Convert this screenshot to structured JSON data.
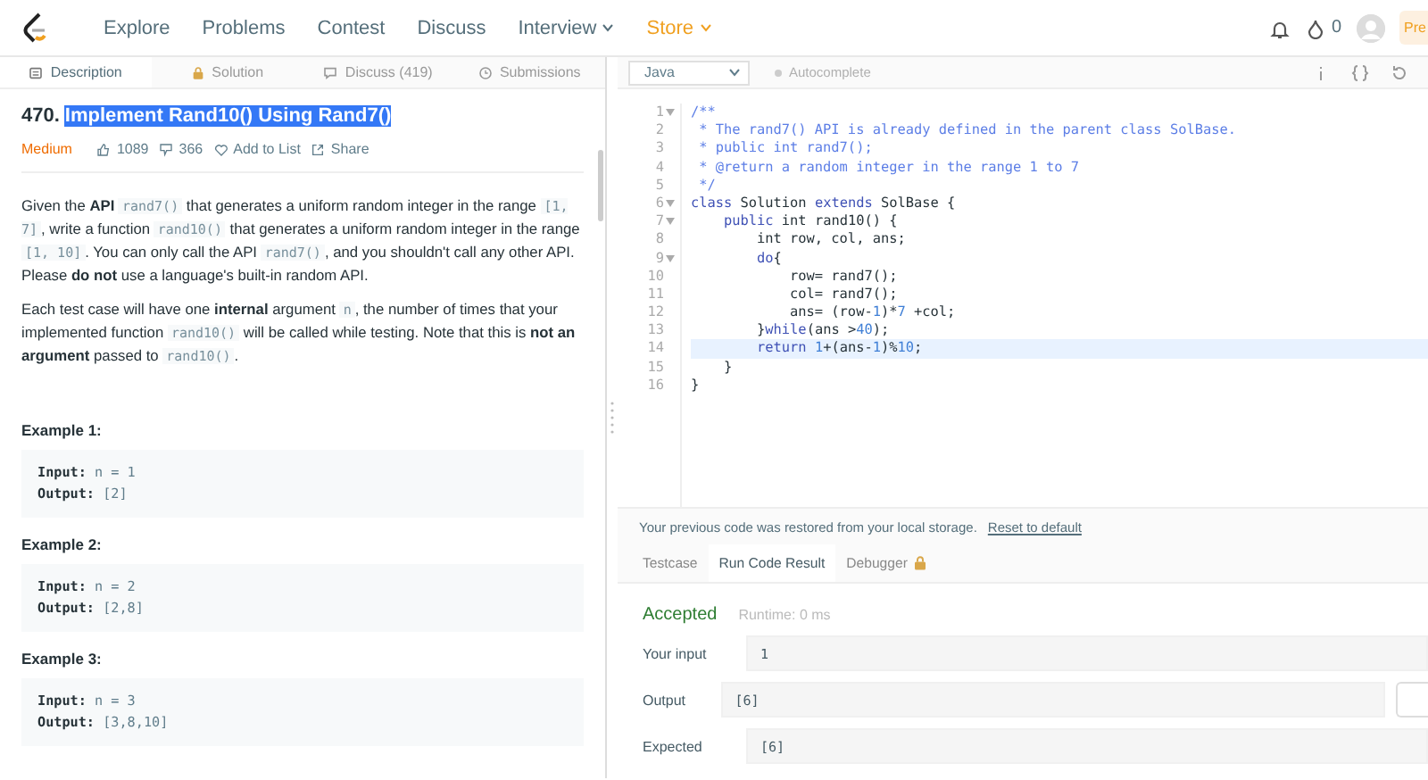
{
  "nav": {
    "links": [
      {
        "label": "Explore",
        "kind": "plain"
      },
      {
        "label": "Problems",
        "kind": "plain"
      },
      {
        "label": "Contest",
        "kind": "plain"
      },
      {
        "label": "Discuss",
        "kind": "plain"
      },
      {
        "label": "Interview",
        "kind": "menu"
      },
      {
        "label": "Store",
        "kind": "store"
      }
    ],
    "points": "0",
    "premium": "Pre"
  },
  "tabs": [
    {
      "label": "Description",
      "kind": "description",
      "selected": true
    },
    {
      "label": "Solution",
      "kind": "solution",
      "selected": false
    },
    {
      "label": "Discuss (419)",
      "kind": "discuss",
      "selected": false
    },
    {
      "label": "Submissions",
      "kind": "submissions",
      "selected": false
    }
  ],
  "problem": {
    "number": "470.",
    "title": "Implement Rand10() Using Rand7()",
    "highlighted": true,
    "difficulty": "Medium",
    "likes": "1089",
    "dislikes": "366",
    "add_to_list": "Add to List",
    "share": "Share",
    "paragraphs": [
      [
        {
          "kind": "text",
          "text": "Given the "
        },
        {
          "kind": "bold",
          "text": "API "
        },
        {
          "kind": "code",
          "text": "rand7()"
        },
        {
          "kind": "text",
          "text": " that generates a uniform random integer in the range "
        },
        {
          "kind": "code",
          "text": "[1, 7]"
        },
        {
          "kind": "text",
          "text": ", write a function "
        },
        {
          "kind": "code",
          "text": "rand10()"
        },
        {
          "kind": "text",
          "text": " that generates a uniform random integer in the range "
        },
        {
          "kind": "code",
          "text": "[1, 10]"
        },
        {
          "kind": "text",
          "text": ". You can only call the API "
        },
        {
          "kind": "code",
          "text": "rand7()"
        },
        {
          "kind": "text",
          "text": ", and you shouldn't call any other API. Please "
        },
        {
          "kind": "bold",
          "text": "do not"
        },
        {
          "kind": "text",
          "text": " use a language's built-in random API."
        }
      ],
      [
        {
          "kind": "text",
          "text": "Each test case will have one "
        },
        {
          "kind": "bold",
          "text": "internal"
        },
        {
          "kind": "text",
          "text": " argument "
        },
        {
          "kind": "code",
          "text": "n"
        },
        {
          "kind": "text",
          "text": ", the number of times that your implemented function "
        },
        {
          "kind": "code",
          "text": "rand10()"
        },
        {
          "kind": "text",
          "text": " will be called while testing. Note that this is "
        },
        {
          "kind": "bold",
          "text": "not an argument"
        },
        {
          "kind": "text",
          "text": " passed to "
        },
        {
          "kind": "code",
          "text": "rand10()"
        },
        {
          "kind": "text",
          "text": "."
        }
      ]
    ],
    "examples": [
      {
        "title": "Example 1:",
        "lines": [
          {
            "label": "Input:",
            "value": "n = 1"
          },
          {
            "label": "Output:",
            "value": "[2]"
          }
        ]
      },
      {
        "title": "Example 2:",
        "lines": [
          {
            "label": "Input:",
            "value": "n = 2"
          },
          {
            "label": "Output:",
            "value": "[2,8]"
          }
        ]
      },
      {
        "title": "Example 3:",
        "lines": [
          {
            "label": "Input:",
            "value": "n = 3"
          },
          {
            "label": "Output:",
            "value": "[3,8,10]"
          }
        ]
      }
    ]
  },
  "editor": {
    "language": "Java",
    "autocomplete": "Autocomplete",
    "autocomplete_on": false,
    "lines": [
      {
        "number": "1",
        "fold": true,
        "highlighted": false,
        "tokens": [
          {
            "kind": "comment",
            "text": "/**"
          }
        ]
      },
      {
        "number": "2",
        "fold": false,
        "highlighted": false,
        "tokens": [
          {
            "kind": "comment",
            "text": " * The rand7() API is already defined in the parent class SolBase."
          }
        ]
      },
      {
        "number": "3",
        "fold": false,
        "highlighted": false,
        "tokens": [
          {
            "kind": "comment",
            "text": " * public int rand7();"
          }
        ]
      },
      {
        "number": "4",
        "fold": false,
        "highlighted": false,
        "tokens": [
          {
            "kind": "comment",
            "text": " * @return a random integer in the range 1 to 7"
          }
        ]
      },
      {
        "number": "5",
        "fold": false,
        "highlighted": false,
        "tokens": [
          {
            "kind": "comment",
            "text": " */"
          }
        ]
      },
      {
        "number": "6",
        "fold": true,
        "highlighted": false,
        "tokens": [
          {
            "kind": "keyword",
            "text": "class"
          },
          {
            "kind": "plain",
            "text": " Solution "
          },
          {
            "kind": "keyword",
            "text": "extends"
          },
          {
            "kind": "plain",
            "text": " SolBase {"
          }
        ]
      },
      {
        "number": "7",
        "fold": true,
        "highlighted": false,
        "tokens": [
          {
            "kind": "keyword",
            "text": "    public"
          },
          {
            "kind": "plain",
            "text": " int rand10() {"
          }
        ]
      },
      {
        "number": "8",
        "fold": false,
        "highlighted": false,
        "tokens": [
          {
            "kind": "plain",
            "text": "        int row, col, ans;"
          }
        ]
      },
      {
        "number": "9",
        "fold": true,
        "highlighted": false,
        "tokens": [
          {
            "kind": "keyword",
            "text": "        do"
          },
          {
            "kind": "plain",
            "text": "{"
          }
        ]
      },
      {
        "number": "10",
        "fold": false,
        "highlighted": false,
        "tokens": [
          {
            "kind": "plain",
            "text": "            row= rand7();"
          }
        ]
      },
      {
        "number": "11",
        "fold": false,
        "highlighted": false,
        "tokens": [
          {
            "kind": "plain",
            "text": "            col= rand7();"
          }
        ]
      },
      {
        "number": "12",
        "fold": false,
        "highlighted": false,
        "tokens": [
          {
            "kind": "plain",
            "text": "            ans= (row-"
          },
          {
            "kind": "number",
            "text": "1"
          },
          {
            "kind": "plain",
            "text": ")*"
          },
          {
            "kind": "number",
            "text": "7"
          },
          {
            "kind": "plain",
            "text": " +col;"
          }
        ]
      },
      {
        "number": "13",
        "fold": false,
        "highlighted": false,
        "tokens": [
          {
            "kind": "plain",
            "text": "        }"
          },
          {
            "kind": "keyword",
            "text": "while"
          },
          {
            "kind": "plain",
            "text": "(ans >"
          },
          {
            "kind": "number",
            "text": "40"
          },
          {
            "kind": "plain",
            "text": ");"
          }
        ]
      },
      {
        "number": "14",
        "fold": false,
        "highlighted": true,
        "tokens": [
          {
            "kind": "keyword",
            "text": "        return "
          },
          {
            "kind": "number",
            "text": "1"
          },
          {
            "kind": "plain",
            "text": "+(ans-"
          },
          {
            "kind": "number",
            "text": "1"
          },
          {
            "kind": "plain",
            "text": ")%"
          },
          {
            "kind": "number",
            "text": "10"
          },
          {
            "kind": "plain",
            "text": ";"
          }
        ]
      },
      {
        "number": "15",
        "fold": false,
        "highlighted": false,
        "tokens": [
          {
            "kind": "plain",
            "text": "    }"
          }
        ]
      },
      {
        "number": "16",
        "fold": false,
        "highlighted": false,
        "tokens": [
          {
            "kind": "plain",
            "text": "}"
          }
        ]
      }
    ]
  },
  "notice": {
    "text": "Your previous code was restored from your local storage.",
    "link": "Reset to default"
  },
  "console": {
    "tabs": [
      {
        "label": "Testcase",
        "locked": false,
        "selected": false
      },
      {
        "label": "Run Code Result",
        "locked": false,
        "selected": true
      },
      {
        "label": "Debugger",
        "locked": true,
        "selected": false
      }
    ],
    "status": "Accepted",
    "runtime": "Runtime: 0 ms",
    "rows": [
      {
        "label": "Your input",
        "value": "1",
        "diff_button": false
      },
      {
        "label": "Output",
        "value": "[6]",
        "diff_button": true
      },
      {
        "label": "Expected",
        "value": "[6]",
        "diff_button": false
      }
    ]
  }
}
